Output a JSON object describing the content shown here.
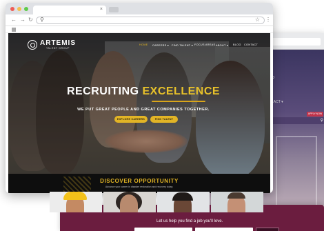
{
  "site": {
    "brand": "ARTEMIS",
    "brand_sub": "TALENT GROUP",
    "nav": [
      {
        "label": "HOME",
        "active": true
      },
      {
        "label": "CAREERS ▾",
        "active": false
      },
      {
        "label": "FIND TALENT ▾",
        "active": false
      },
      {
        "label": "FOCUS AREAS",
        "active": false
      },
      {
        "label": "ABOUT ▾",
        "active": false
      },
      {
        "label": "BLOG",
        "active": false
      },
      {
        "label": "CONTACT",
        "active": false
      }
    ],
    "headline_1": "RECRUITING",
    "headline_2": "EXCELLENCE",
    "tagline": "WE PUT GREAT PEOPLE AND GREAT COMPANIES TOGETHER.",
    "cta_primary": "EXPLORE CAREERS",
    "cta_secondary": "FIND TALENT",
    "discover_title": "DISCOVER OPPORTUNITY",
    "discover_sub": "Advance your career in disaster restoration and recovery today."
  },
  "back_site": {
    "nav_partial": "O",
    "nav_partial2": "LACT ▾",
    "apply_label": "APPLY NOW",
    "search_icon": "search-icon"
  },
  "job_strip": {
    "text": "Let us help you find a job you'll love."
  },
  "browser": {
    "tab_close": "×",
    "back": "←",
    "forward": "→",
    "reload": "↻",
    "search_glyph": "⚲",
    "star_glyph": "☆",
    "menu_glyph": "⋮"
  },
  "colors": {
    "accent_gold": "#e2b426",
    "maroon": "#6b1d3f",
    "dark_band": "#0e0e0e"
  }
}
